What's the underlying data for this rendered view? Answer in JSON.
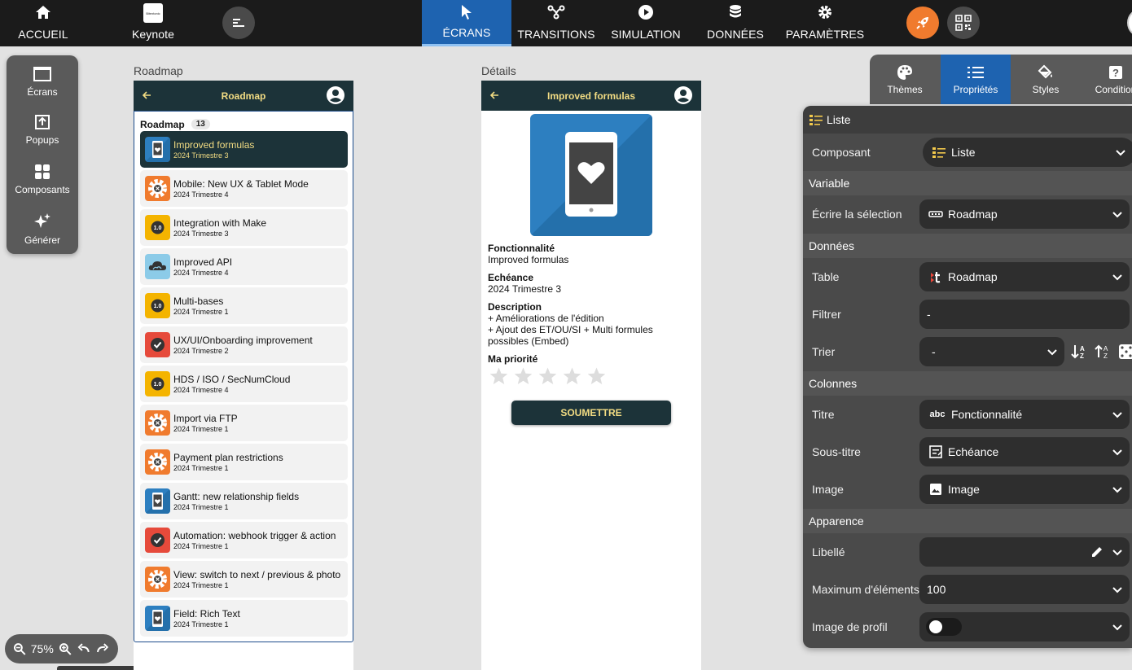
{
  "topbar": {
    "home_label": "ACCUEIL",
    "app_name": "Keynote",
    "app_logo_text": "Bitextonic",
    "tabs": [
      {
        "label": "ÉCRANS",
        "icon": "cursor-icon",
        "active": true
      },
      {
        "label": "TRANSITIONS",
        "icon": "transitions-icon"
      },
      {
        "label": "SIMULATION",
        "icon": "play-icon"
      },
      {
        "label": "DONNÉES",
        "icon": "database-icon"
      },
      {
        "label": "PARAMÈTRES",
        "icon": "gear-icon"
      }
    ]
  },
  "left_panel": {
    "items": [
      {
        "label": "Écrans",
        "icon": "screen-icon"
      },
      {
        "label": "Popups",
        "icon": "popup-icon"
      },
      {
        "label": "Composants",
        "icon": "components-icon"
      },
      {
        "label": "Générer",
        "icon": "sparkle-icon"
      }
    ]
  },
  "zoom": {
    "level": "75%"
  },
  "screens": {
    "roadmap_caption": "Roadmap",
    "details_caption": "Détails"
  },
  "roadmap_screen": {
    "header_title": "Roadmap",
    "list_title": "Roadmap",
    "count": "13",
    "items": [
      {
        "title": "Improved formulas",
        "sub": "2024 Trimestre 3",
        "thumb": "tablet-heart-icon",
        "selected": true
      },
      {
        "title": "Mobile: New UX & Tablet Mode",
        "sub": "2024 Trimestre 4",
        "thumb": "gear-orange-icon"
      },
      {
        "title": "Integration with Make",
        "sub": "2024 Trimestre 3",
        "thumb": "version-badge-icon"
      },
      {
        "title": "Improved API",
        "sub": "2024 Trimestre 4",
        "thumb": "cloud-icon"
      },
      {
        "title": "Multi-bases",
        "sub": "2024 Trimestre 1",
        "thumb": "version-badge-icon"
      },
      {
        "title": "UX/UI/Onboarding improvement",
        "sub": "2024 Trimestre 2",
        "thumb": "check-red-icon"
      },
      {
        "title": "HDS / ISO / SecNumCloud",
        "sub": "2024 Trimestre 4",
        "thumb": "version-badge-icon"
      },
      {
        "title": "Import via FTP",
        "sub": "2024 Trimestre 1",
        "thumb": "gear-orange-icon"
      },
      {
        "title": "Payment plan restrictions",
        "sub": "2024 Trimestre 1",
        "thumb": "gear-orange-icon"
      },
      {
        "title": "Gantt: new relationship fields",
        "sub": "2024 Trimestre 1",
        "thumb": "tablet-heart-icon"
      },
      {
        "title": "Automation: webhook trigger & action",
        "sub": "2024 Trimestre 1",
        "thumb": "check-red-icon"
      },
      {
        "title": "View: switch to next / previous & photo",
        "sub": "2024 Trimestre 1",
        "thumb": "gear-orange-icon"
      },
      {
        "title": "Field: Rich Text",
        "sub": "2024 Trimestre 1",
        "thumb": "tablet-heart-icon"
      }
    ]
  },
  "details_screen": {
    "header_title": "Improved formulas",
    "feature_label": "Fonctionnalité",
    "feature_value": "Improved formulas",
    "due_label": "Echéance",
    "due_value": "2024 Trimestre 3",
    "desc_label": "Description",
    "desc_line1": "+ Améliorations de l'édition",
    "desc_line2": "+ Ajout des ET/OU/SI + Multi formules possibles (Embed)",
    "priority_label": "Ma priorité",
    "rating": 0,
    "rating_max": 5,
    "submit_label": "SOUMETTRE"
  },
  "right_tabs": [
    {
      "label": "Thèmes",
      "icon": "palette-icon"
    },
    {
      "label": "Propriétés",
      "icon": "list-icon",
      "active": true
    },
    {
      "label": "Styles",
      "icon": "paint-bucket-icon"
    },
    {
      "label": "Condition",
      "icon": "question-icon"
    }
  ],
  "properties": {
    "panel_title": "Liste",
    "component_label": "Composant",
    "component_value": "Liste",
    "section_variable": "Variable",
    "write_sel_label": "Écrire la sélection",
    "write_sel_value": "Roadmap",
    "section_data": "Données",
    "table_label": "Table",
    "table_value": "Roadmap",
    "filter_label": "Filtrer",
    "filter_value": "-",
    "sort_label": "Trier",
    "sort_value": "-",
    "section_columns": "Colonnes",
    "title_label": "Titre",
    "title_value": "Fonctionnalité",
    "subtitle_label": "Sous-titre",
    "subtitle_value": "Echéance",
    "image_label": "Image",
    "image_value": "Image",
    "section_appearance": "Apparence",
    "caption_label": "Libellé",
    "caption_value": "",
    "max_label": "Maximum d'éléments",
    "max_value": "100",
    "profile_label": "Image de profil",
    "profile_enabled": false
  },
  "colors": {
    "topbar": "#1b1b1b",
    "accent": "#1e63b0",
    "phone_header": "#1c3339",
    "phone_title": "#f2dc83",
    "panel": "#4a4a4a",
    "rocket": "#f07b2e"
  }
}
